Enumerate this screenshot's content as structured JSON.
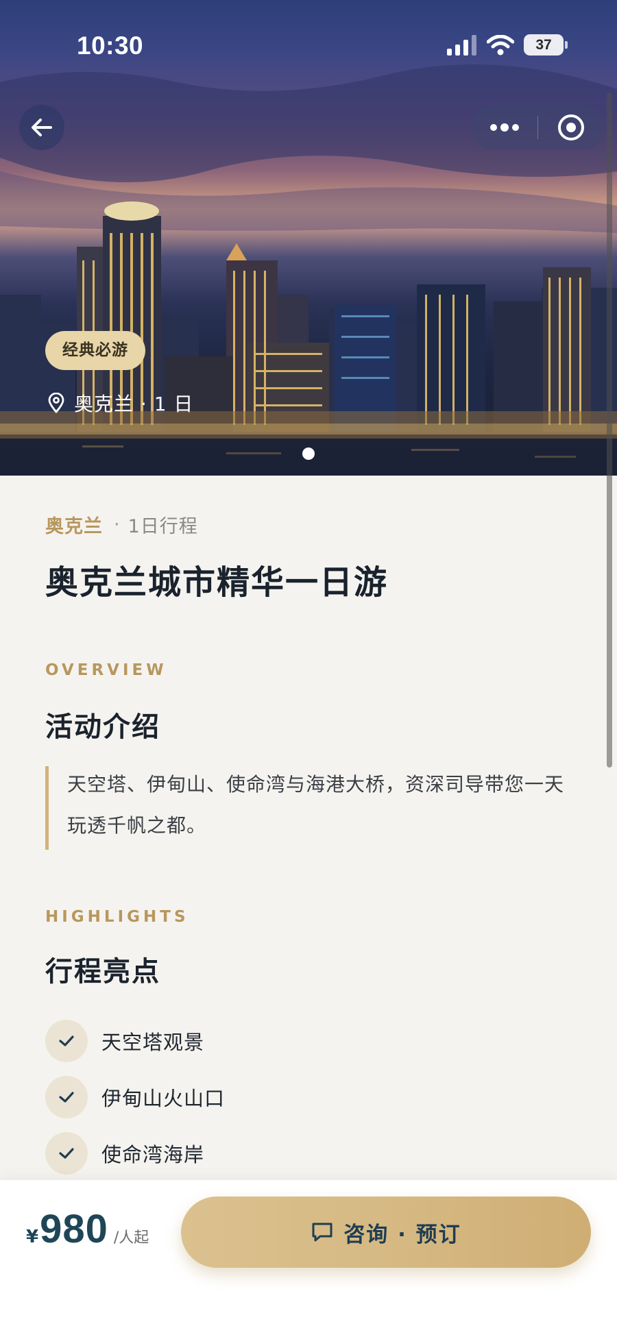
{
  "status_bar": {
    "time": "10:30",
    "battery": "37"
  },
  "hero": {
    "tag": "经典必游",
    "location": "奥克兰 · 1 日"
  },
  "header": {
    "city": "奥克兰",
    "duration": "1日行程",
    "title": "奥克兰城市精华一日游"
  },
  "overview": {
    "kicker": "OVERVIEW",
    "title": "活动介绍",
    "description": "天空塔、伊甸山、使命湾与海港大桥，资深司导带您一天玩透千帆之都。"
  },
  "highlights": {
    "kicker": "HIGHLIGHTS",
    "title": "行程亮点",
    "items": [
      {
        "label": "天空塔观景"
      },
      {
        "label": "伊甸山火山口"
      },
      {
        "label": "使命湾海岸"
      }
    ]
  },
  "bottom_bar": {
    "currency": "¥",
    "price": "980",
    "unit": "/人起",
    "cta_label": "咨询 · 预订"
  },
  "colors": {
    "accent_gold": "#b8975e",
    "cta_gold": "#d6b983",
    "price_blue": "#1f4657"
  }
}
